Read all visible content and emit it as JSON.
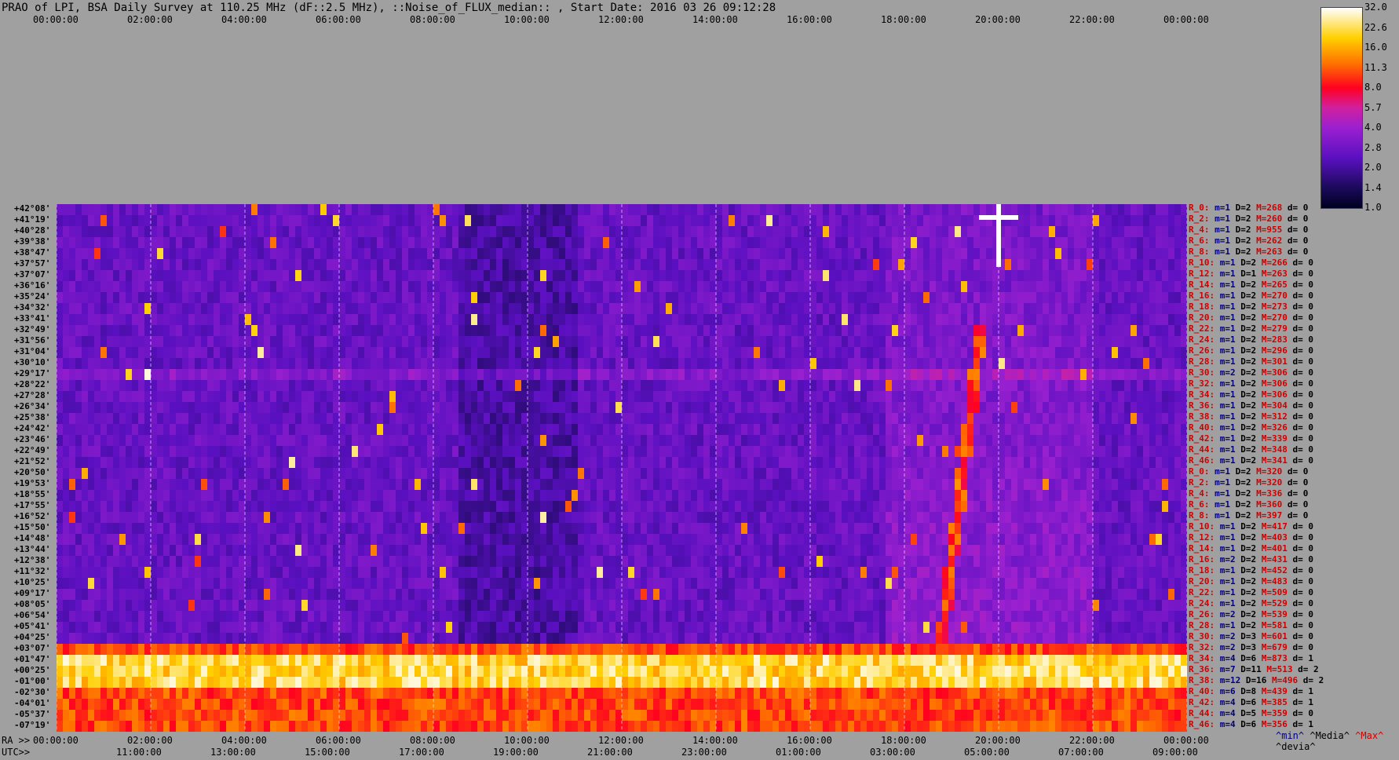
{
  "title": "PRAO of LPI, BSA Daily Survey at 110.25 MHz (dF::2.5 MHz), ::Noise_of_FLUX_median:: , Start Date: 2016 03 26 09:12:28",
  "top_axis": [
    "00:00:00",
    "02:00:00",
    "04:00:00",
    "06:00:00",
    "08:00:00",
    "10:00:00",
    "12:00:00",
    "14:00:00",
    "16:00:00",
    "18:00:00",
    "20:00:00",
    "22:00:00",
    "00:00:00"
  ],
  "ra_axis": {
    "label": "RA >>",
    "ticks": [
      "00:00:00",
      "02:00:00",
      "04:00:00",
      "06:00:00",
      "08:00:00",
      "10:00:00",
      "12:00:00",
      "14:00:00",
      "16:00:00",
      "18:00:00",
      "20:00:00",
      "22:00:00",
      "00:00:00"
    ]
  },
  "utc_axis": {
    "label": "UTC>>",
    "ticks": [
      "11:00:00",
      "13:00:00",
      "15:00:00",
      "17:00:00",
      "19:00:00",
      "21:00:00",
      "23:00:00",
      "01:00:00",
      "03:00:00",
      "05:00:00",
      "07:00:00",
      "09:00:00"
    ]
  },
  "colorbar": {
    "ticks": [
      "32.0",
      "22.6",
      "16.0",
      "11.3",
      "8.0",
      "5.7",
      "4.0",
      "2.8",
      "2.0",
      "1.4",
      "1.0"
    ]
  },
  "declinations": [
    "+42°08'",
    "+41°19'",
    "+40°28'",
    "+39°38'",
    "+38°47'",
    "+37°57'",
    "+37°07'",
    "+36°16'",
    "+35°24'",
    "+34°32'",
    "+33°41'",
    "+32°49'",
    "+31°56'",
    "+31°04'",
    "+30°10'",
    "+29°17'",
    "+28°22'",
    "+27°28'",
    "+26°34'",
    "+25°38'",
    "+24°42'",
    "+23°46'",
    "+22°49'",
    "+21°52'",
    "+20°50'",
    "+19°53'",
    "+18°55'",
    "+17°55'",
    "+16°52'",
    "+15°50'",
    "+14°48'",
    "+13°44'",
    "+12°38'",
    "+11°32'",
    "+10°25'",
    "+09°17'",
    "+08°05'",
    "+06°54'",
    "+05°41'",
    "+04°25'",
    "+03°07'",
    "+01°47'",
    "+00°25'",
    "-01°00'",
    "-02°30'",
    "-04°01'",
    "-05°37'",
    "-07°19'"
  ],
  "row_stats": [
    {
      "r": "R_0:",
      "m": "m=1",
      "D": "D=2",
      "M": "M=268",
      "d": "d= 0"
    },
    {
      "r": "R_2:",
      "m": "m=1",
      "D": "D=2",
      "M": "M=260",
      "d": "d= 0"
    },
    {
      "r": "R_4:",
      "m": "m=1",
      "D": "D=2",
      "M": "M=955",
      "d": "d= 0"
    },
    {
      "r": "R_6:",
      "m": "m=1",
      "D": "D=2",
      "M": "M=262",
      "d": "d= 0"
    },
    {
      "r": "R_8:",
      "m": "m=1",
      "D": "D=2",
      "M": "M=263",
      "d": "d= 0"
    },
    {
      "r": "R_10:",
      "m": "m=1",
      "D": "D=2",
      "M": "M=266",
      "d": "d= 0"
    },
    {
      "r": "R_12:",
      "m": "m=1",
      "D": "D=1",
      "M": "M=263",
      "d": "d= 0"
    },
    {
      "r": "R_14:",
      "m": "m=1",
      "D": "D=2",
      "M": "M=265",
      "d": "d= 0"
    },
    {
      "r": "R_16:",
      "m": "m=1",
      "D": "D=2",
      "M": "M=270",
      "d": "d= 0"
    },
    {
      "r": "R_18:",
      "m": "m=1",
      "D": "D=2",
      "M": "M=273",
      "d": "d= 0"
    },
    {
      "r": "R_20:",
      "m": "m=1",
      "D": "D=2",
      "M": "M=270",
      "d": "d= 0"
    },
    {
      "r": "R_22:",
      "m": "m=1",
      "D": "D=2",
      "M": "M=279",
      "d": "d= 0"
    },
    {
      "r": "R_24:",
      "m": "m=1",
      "D": "D=2",
      "M": "M=283",
      "d": "d= 0"
    },
    {
      "r": "R_26:",
      "m": "m=1",
      "D": "D=2",
      "M": "M=296",
      "d": "d= 0"
    },
    {
      "r": "R_28:",
      "m": "m=1",
      "D": "D=2",
      "M": "M=301",
      "d": "d= 0"
    },
    {
      "r": "R_30:",
      "m": "m=2",
      "D": "D=2",
      "M": "M=306",
      "d": "d= 0"
    },
    {
      "r": "R_32:",
      "m": "m=1",
      "D": "D=2",
      "M": "M=306",
      "d": "d= 0"
    },
    {
      "r": "R_34:",
      "m": "m=1",
      "D": "D=2",
      "M": "M=306",
      "d": "d= 0"
    },
    {
      "r": "R_36:",
      "m": "m=1",
      "D": "D=2",
      "M": "M=304",
      "d": "d= 0"
    },
    {
      "r": "R_38:",
      "m": "m=1",
      "D": "D=2",
      "M": "M=312",
      "d": "d= 0"
    },
    {
      "r": "R_40:",
      "m": "m=1",
      "D": "D=2",
      "M": "M=326",
      "d": "d= 0"
    },
    {
      "r": "R_42:",
      "m": "m=1",
      "D": "D=2",
      "M": "M=339",
      "d": "d= 0"
    },
    {
      "r": "R_44:",
      "m": "m=1",
      "D": "D=2",
      "M": "M=348",
      "d": "d= 0"
    },
    {
      "r": "R_46:",
      "m": "m=1",
      "D": "D=2",
      "M": "M=341",
      "d": "d= 0"
    },
    {
      "r": "R_0:",
      "m": "m=1",
      "D": "D=2",
      "M": "M=320",
      "d": "d= 0"
    },
    {
      "r": "R_2:",
      "m": "m=1",
      "D": "D=2",
      "M": "M=320",
      "d": "d= 0"
    },
    {
      "r": "R_4:",
      "m": "m=1",
      "D": "D=2",
      "M": "M=336",
      "d": "d= 0"
    },
    {
      "r": "R_6:",
      "m": "m=1",
      "D": "D=2",
      "M": "M=360",
      "d": "d= 0"
    },
    {
      "r": "R_8:",
      "m": "m=1",
      "D": "D=2",
      "M": "M=397",
      "d": "d= 0"
    },
    {
      "r": "R_10:",
      "m": "m=1",
      "D": "D=2",
      "M": "M=417",
      "d": "d= 0"
    },
    {
      "r": "R_12:",
      "m": "m=1",
      "D": "D=2",
      "M": "M=403",
      "d": "d= 0"
    },
    {
      "r": "R_14:",
      "m": "m=1",
      "D": "D=2",
      "M": "M=401",
      "d": "d= 0"
    },
    {
      "r": "R_16:",
      "m": "m=2",
      "D": "D=2",
      "M": "M=431",
      "d": "d= 0"
    },
    {
      "r": "R_18:",
      "m": "m=1",
      "D": "D=2",
      "M": "M=452",
      "d": "d= 0"
    },
    {
      "r": "R_20:",
      "m": "m=1",
      "D": "D=2",
      "M": "M=483",
      "d": "d= 0"
    },
    {
      "r": "R_22:",
      "m": "m=1",
      "D": "D=2",
      "M": "M=509",
      "d": "d= 0"
    },
    {
      "r": "R_24:",
      "m": "m=1",
      "D": "D=2",
      "M": "M=529",
      "d": "d= 0"
    },
    {
      "r": "R_26:",
      "m": "m=2",
      "D": "D=2",
      "M": "M=539",
      "d": "d= 0"
    },
    {
      "r": "R_28:",
      "m": "m=1",
      "D": "D=2",
      "M": "M=581",
      "d": "d= 0"
    },
    {
      "r": "R_30:",
      "m": "m=2",
      "D": "D=3",
      "M": "M=601",
      "d": "d= 0"
    },
    {
      "r": "R_32:",
      "m": "m=2",
      "D": "D=3",
      "M": "M=679",
      "d": "d= 0"
    },
    {
      "r": "R_34:",
      "m": "m=4",
      "D": "D=6",
      "M": "M=873",
      "d": "d= 1"
    },
    {
      "r": "R_36:",
      "m": "m=7",
      "D": "D=11",
      "M": "M=513",
      "d": "d= 2"
    },
    {
      "r": "R_38:",
      "m": "m=12",
      "D": "D=16",
      "M": "M=496",
      "d": "d= 2"
    },
    {
      "r": "R_40:",
      "m": "m=6",
      "D": "D=8",
      "M": "M=439",
      "d": "d= 1"
    },
    {
      "r": "R_42:",
      "m": "m=4",
      "D": "D=6",
      "M": "M=385",
      "d": "d= 1"
    },
    {
      "r": "R_44:",
      "m": "m=4",
      "D": "D=5",
      "M": "M=359",
      "d": "d= 0"
    },
    {
      "r": "R_46:",
      "m": "m=4",
      "D": "D=6",
      "M": "M=356",
      "d": "d= 1"
    }
  ],
  "legend": {
    "min": "^min^",
    "median": "^Media^",
    "max": "^Max^",
    "dev": "^devia^"
  },
  "chart_data": {
    "type": "heatmap",
    "title": "PRAO of LPI, BSA Daily Survey at 110.25 MHz (dF::2.5 MHz), ::Noise_of_FLUX_median:: , Start Date: 2016 03 26 09:12:28",
    "x_axis": "RA (00:00:00 to 24:00:00)",
    "y_axis": "Declination (+42°08' to -07°19')",
    "color_scale": {
      "min": 1.0,
      "max": 32.0,
      "scale": "log2"
    },
    "features": [
      {
        "description": "bright band",
        "dec_range": [
          "+01°47'",
          "-07°19'"
        ],
        "level": "high (8-32)"
      },
      {
        "description": "sun track diagonal",
        "ra_range": [
          "18:50",
          "20:00"
        ],
        "level": "medium-high"
      },
      {
        "description": "bright source",
        "ra": "20:00",
        "dec": "+41°19'",
        "level": "32"
      }
    ]
  }
}
